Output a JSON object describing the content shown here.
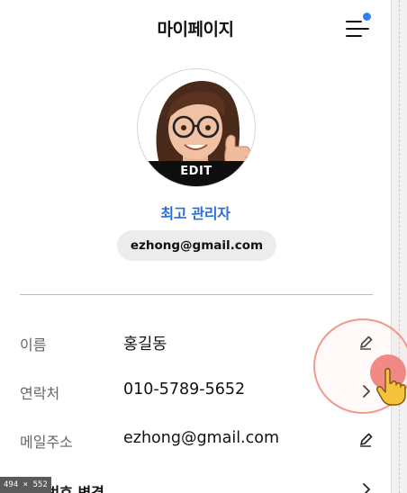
{
  "header": {
    "title": "마이페이지"
  },
  "profile": {
    "avatar_edit_label": "EDIT",
    "role": "최고 관리자",
    "email": "ezhong@gmail.com"
  },
  "fields": [
    {
      "label": "이름",
      "value": "홍길동",
      "action_icon": "pencil-icon"
    },
    {
      "label": "연락처",
      "value": "010-5789-5652",
      "action_icon": "chevron-right-icon"
    },
    {
      "label": "메일주소",
      "value": "ezhong@gmail.com",
      "action_icon": "pencil-icon"
    },
    {
      "label": "비밀번호 변경",
      "value": "",
      "action_icon": "chevron-right-icon"
    }
  ],
  "overlay": {
    "size_tag": "494 × 552"
  },
  "colors": {
    "accent": "#2c6fd8",
    "notification_dot": "#2f7ff5",
    "pill_bg": "#ececec",
    "click_highlight": "#f07f79"
  }
}
